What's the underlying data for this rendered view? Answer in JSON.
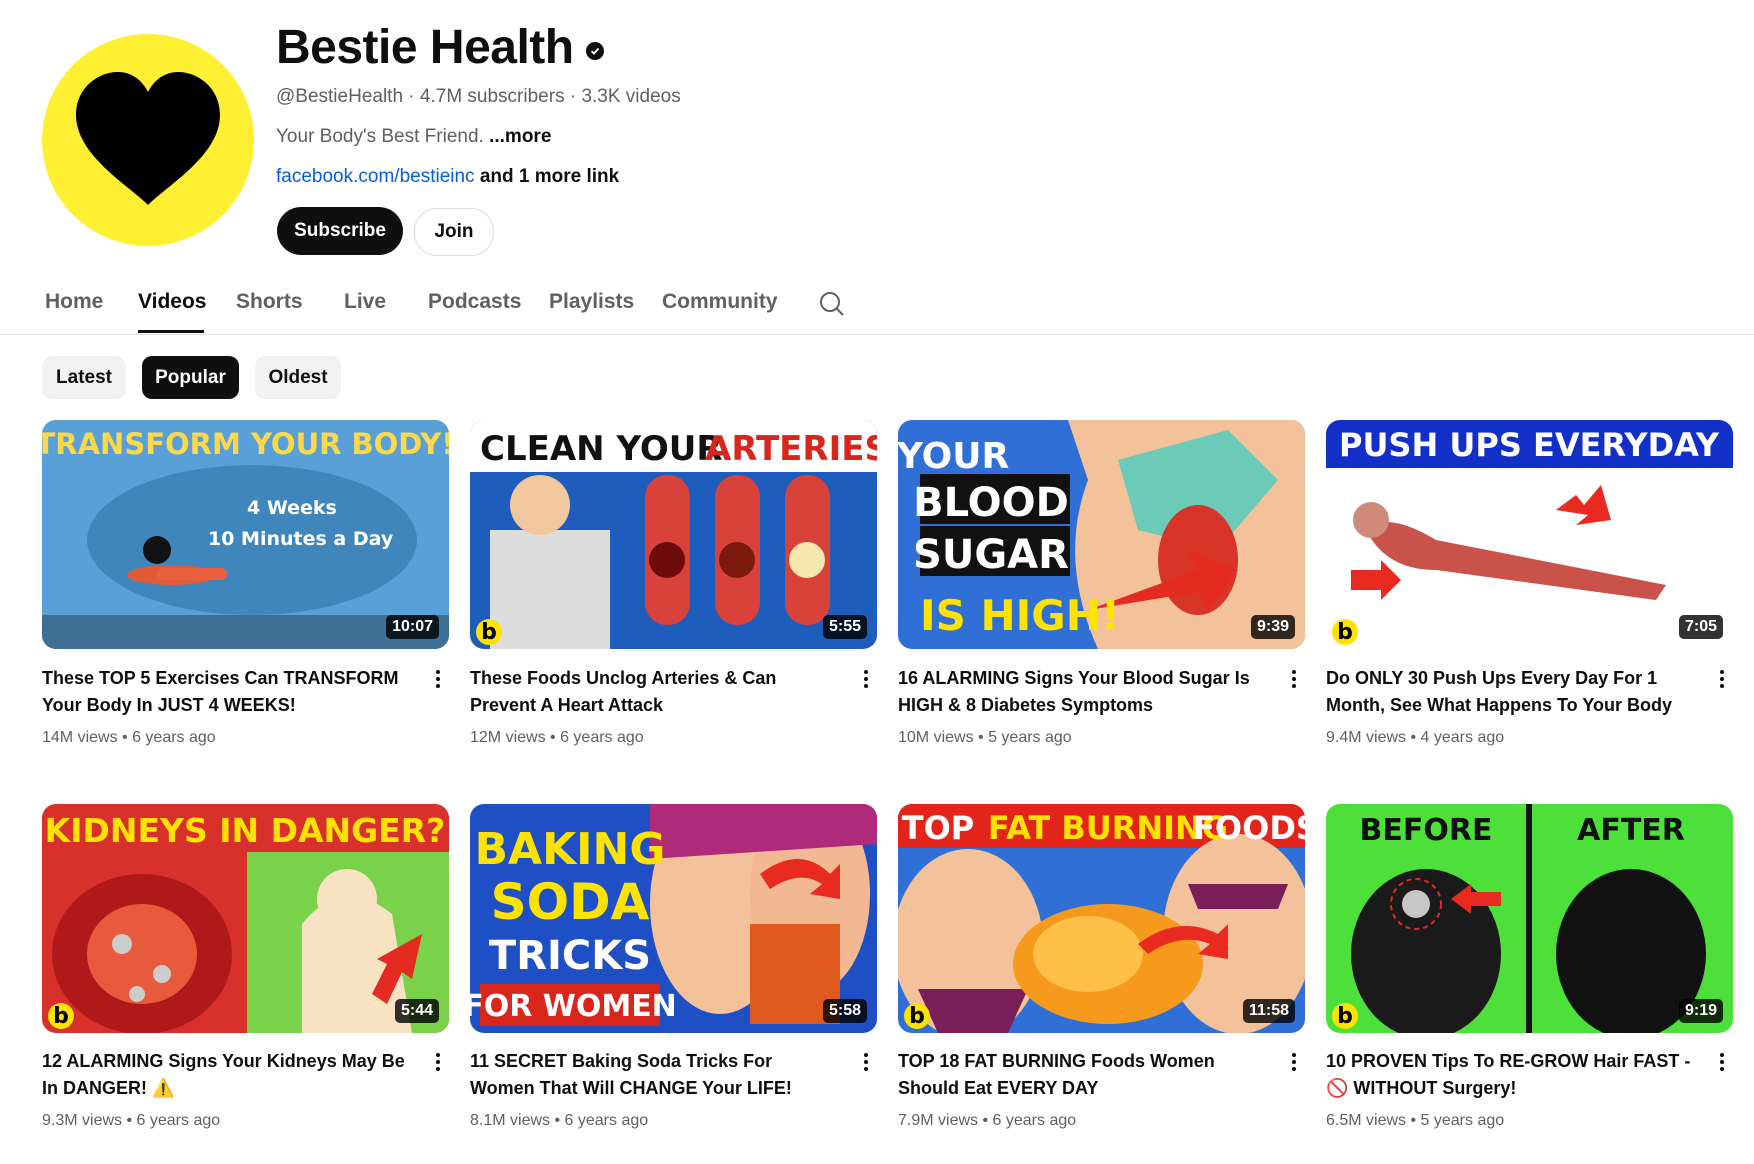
{
  "channel": {
    "name": "Bestie Health",
    "handle_line": "@BestieHealth · 4.7M subscribers · 3.3K videos",
    "description": "Your Body's Best Friend.",
    "more_label": "...more",
    "link": "facebook.com/bestieinc",
    "more_links": "and 1 more link",
    "subscribe_label": "Subscribe",
    "join_label": "Join",
    "avatar_color": "#fff033"
  },
  "tabs": [
    {
      "label": "Home"
    },
    {
      "label": "Videos",
      "active": true
    },
    {
      "label": "Shorts"
    },
    {
      "label": "Live"
    },
    {
      "label": "Podcasts"
    },
    {
      "label": "Playlists"
    },
    {
      "label": "Community"
    }
  ],
  "chips": [
    {
      "label": "Latest"
    },
    {
      "label": "Popular",
      "active": true
    },
    {
      "label": "Oldest"
    }
  ],
  "videos": [
    {
      "title": "These TOP 5 Exercises Can TRANSFORM Your Body In JUST 4 WEEKS!",
      "views": "14M views",
      "age": "6 years ago",
      "duration": "10:07",
      "thumb_text": "TRANSFORM YOUR BODY!",
      "thumb_sub1": "4 Weeks",
      "thumb_sub2": "10 Minutes a Day"
    },
    {
      "title": "These Foods Unclog Arteries & Can Prevent A Heart Attack",
      "views": "12M views",
      "age": "6 years ago",
      "duration": "5:55",
      "thumb_text": "CLEAN YOUR",
      "thumb_text2": "ARTERIES"
    },
    {
      "title": "16 ALARMING Signs Your Blood Sugar Is HIGH & 8 Diabetes Symptoms",
      "views": "10M views",
      "age": "5 years ago",
      "duration": "9:39",
      "thumb_lines": [
        "YOUR",
        "BLOOD",
        "SUGAR",
        "IS HIGH!"
      ]
    },
    {
      "title": "Do ONLY 30 Push Ups Every Day For 1 Month, See What Happens To Your Body",
      "views": "9.4M views",
      "age": "4 years ago",
      "duration": "7:05",
      "thumb_text": "PUSH UPS EVERYDAY"
    },
    {
      "title": "12 ALARMING Signs Your Kidneys May Be In DANGER! ⚠️",
      "views": "9.3M views",
      "age": "6 years ago",
      "duration": "5:44",
      "thumb_text": "KIDNEYS IN DANGER?"
    },
    {
      "title": "11 SECRET Baking Soda Tricks For Women That Will CHANGE Your LIFE!",
      "views": "8.1M views",
      "age": "6 years ago",
      "duration": "5:58",
      "thumb_lines": [
        "BAKING",
        "SODA",
        "TRICKS",
        "FOR WOMEN"
      ]
    },
    {
      "title": "TOP 18 FAT BURNING Foods Women Should Eat EVERY DAY",
      "views": "7.9M views",
      "age": "6 years ago",
      "duration": "11:58",
      "thumb_text": "TOP",
      "thumb_text2": "FAT BURNING",
      "thumb_text3": "FOODS"
    },
    {
      "title": "10 PROVEN Tips To RE-GROW Hair FAST - 🚫 WITHOUT Surgery!",
      "views": "6.5M views",
      "age": "5 years ago",
      "duration": "9:19",
      "thumb_text": "BEFORE",
      "thumb_text2": "AFTER"
    }
  ],
  "badge_letter": "b"
}
